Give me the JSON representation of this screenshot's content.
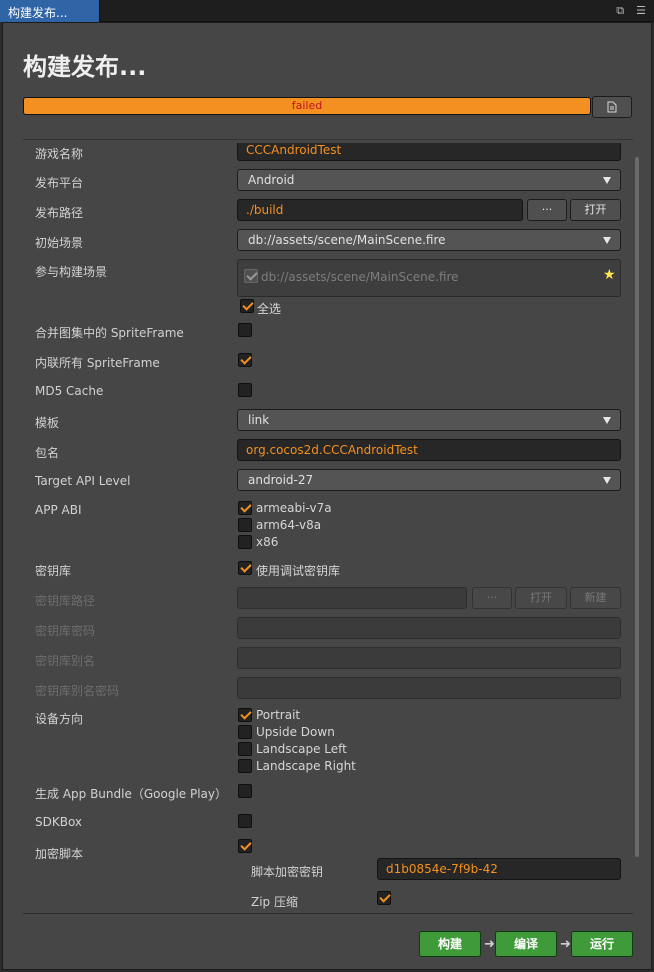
{
  "tab": {
    "label": "构建发布..."
  },
  "title": "构建发布...",
  "progress": {
    "text": "failed",
    "percent": 100
  },
  "colors": {
    "accent": "#f39021",
    "error": "#c3151d",
    "run": "#3f9b3a"
  },
  "form": {
    "game_name": {
      "label": "游戏名称",
      "value": "CCCAndroidTest"
    },
    "platform": {
      "label": "发布平台",
      "value": "Android"
    },
    "build_path": {
      "label": "发布路径",
      "value": "./build",
      "browse": "···",
      "open": "打开"
    },
    "start_scene": {
      "label": "初始场景",
      "value": "db://assets/scene/MainScene.fire"
    },
    "included_scenes": {
      "label": "参与构建场景",
      "item": "db://assets/scene/MainScene.fire",
      "select_all": "全选"
    },
    "merge_spriteframe": {
      "label": "合并图集中的 SpriteFrame",
      "checked": false
    },
    "inline_spriteframe": {
      "label": "内联所有 SpriteFrame",
      "checked": true
    },
    "md5_cache": {
      "label": "MD5 Cache",
      "checked": false
    },
    "template": {
      "label": "模板",
      "value": "link"
    },
    "package_name": {
      "label": "包名",
      "value": "org.cocos2d.CCCAndroidTest"
    },
    "target_api": {
      "label": "Target API Level",
      "value": "android-27"
    },
    "app_abi": {
      "label": "APP ABI",
      "options": [
        "armeabi-v7a",
        "arm64-v8a",
        "x86"
      ],
      "checked": [
        true,
        false,
        false
      ]
    },
    "keystore": {
      "label": "密钥库",
      "option": "使用调试密钥库",
      "checked": true
    },
    "keystore_path": {
      "label": "密钥库路径",
      "browse": "···",
      "open": "打开",
      "new": "新建"
    },
    "keystore_password": {
      "label": "密钥库密码"
    },
    "keystore_alias": {
      "label": "密钥库别名"
    },
    "keystore_alias_password": {
      "label": "密钥库别名密码"
    },
    "orientation": {
      "label": "设备方向",
      "options": [
        "Portrait",
        "Upside Down",
        "Landscape Left",
        "Landscape Right"
      ],
      "checked": [
        true,
        false,
        false,
        false
      ]
    },
    "app_bundle": {
      "label": "生成 App Bundle（Google Play）",
      "checked": false
    },
    "sdkbox": {
      "label": "SDKBox",
      "checked": false
    },
    "encrypt_js": {
      "label": "加密脚本",
      "checked": true
    },
    "encrypt_key": {
      "label": "脚本加密密钥",
      "value": "d1b0854e-7f9b-42"
    },
    "zip_compress": {
      "label": "Zip 压缩",
      "checked": true
    }
  },
  "actions": {
    "build": "构建",
    "compile": "编译",
    "run": "运行"
  }
}
